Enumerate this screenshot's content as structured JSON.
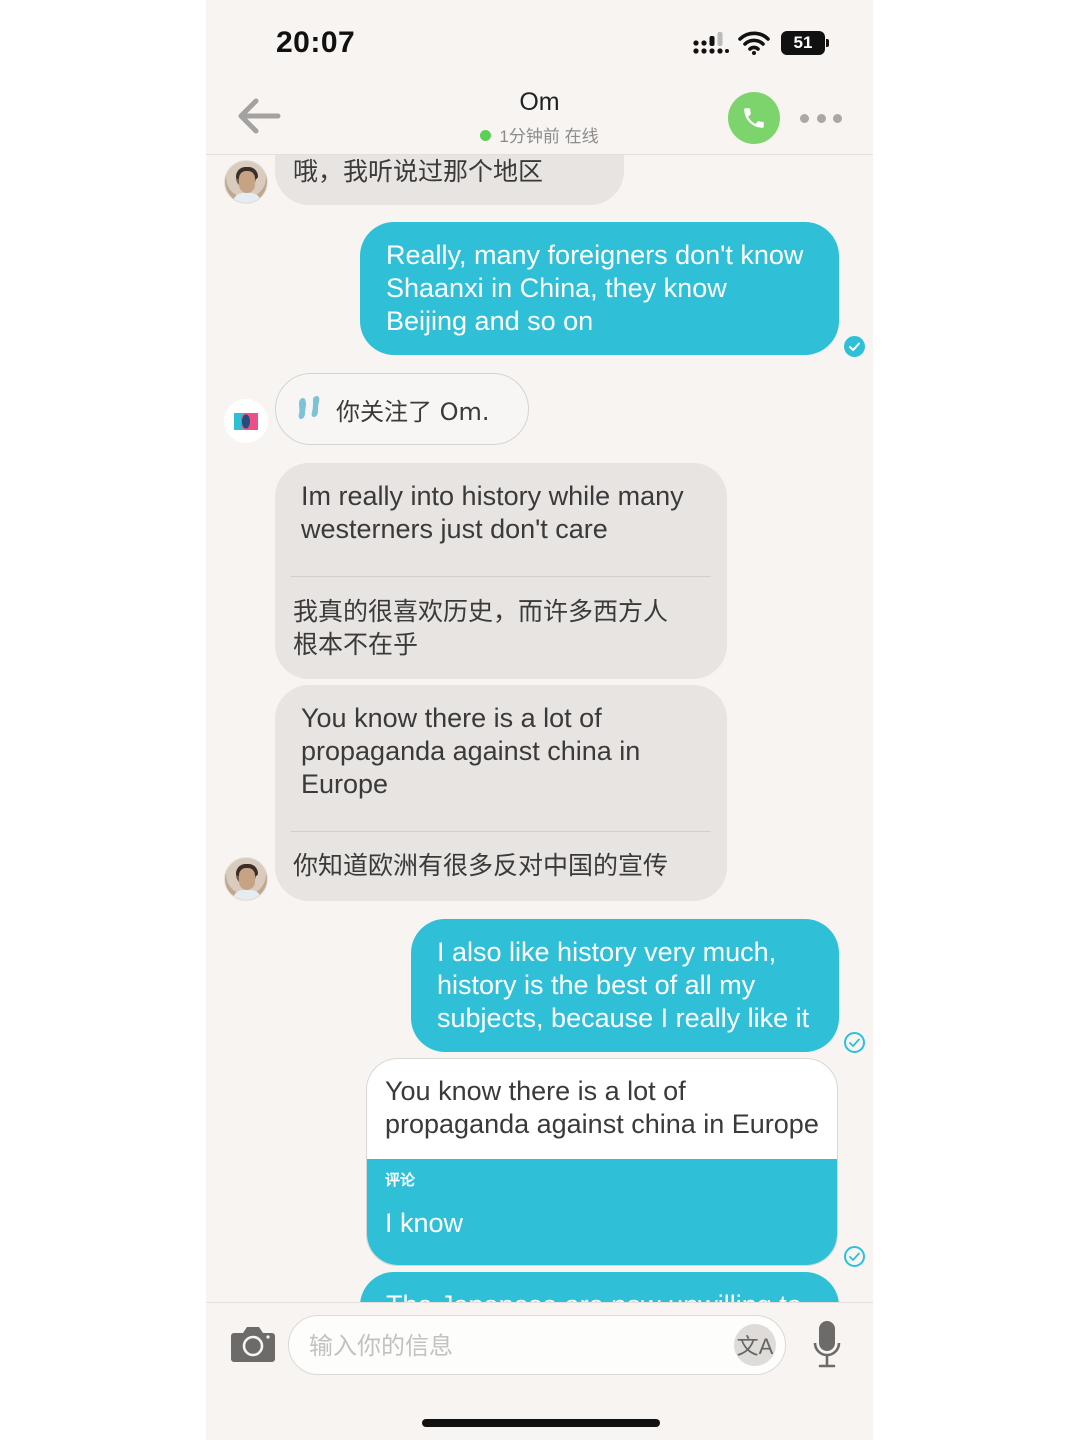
{
  "status_bar": {
    "time": "20:07",
    "battery": "51"
  },
  "header": {
    "contact_name": "Om",
    "status_text": "1分钟前 在线",
    "online_color": "#5ccf55",
    "call_color": "#7dd46c"
  },
  "messages": [
    {
      "direction": "incoming",
      "text": "哦，我听说过那个地区"
    },
    {
      "direction": "outgoing",
      "lines": [
        "Really, many foreigners don't know",
        "Shaanxi in China, they know",
        "Beijing and so on"
      ],
      "status": "read"
    },
    {
      "direction": "system",
      "text": "你关注了 Om.",
      "icon": "footprints-icon"
    },
    {
      "direction": "incoming",
      "lines": [
        "Im really into history while many",
        "westerners just don't care"
      ],
      "translation_lines": [
        "我真的很喜欢历史，而许多西方人",
        "根本不在乎"
      ]
    },
    {
      "direction": "incoming",
      "lines": [
        "You know there is a lot of",
        "propaganda against china in",
        "Europe"
      ],
      "translation_lines": [
        "你知道欧洲有很多反对中国的宣传"
      ]
    },
    {
      "direction": "outgoing",
      "lines": [
        "I also like history very much,",
        "history is the best of all my",
        "subjects, because I really like it"
      ],
      "status": "delivered"
    },
    {
      "direction": "outgoing",
      "type": "comment",
      "quoted_lines": [
        "You know there is a lot of",
        "propaganda against china in Europe"
      ],
      "comment_label": "评论",
      "reply": "I know",
      "status": "delivered"
    },
    {
      "direction": "outgoing",
      "partial": true,
      "text": "The Japanese are now unwilling to"
    }
  ],
  "input_bar": {
    "placeholder": "输入你的信息",
    "translate_glyph": "文A"
  },
  "colors": {
    "accent": "#2fc0d8",
    "incoming_bubble": "#e7e4e1",
    "background": "#f7f4f1"
  }
}
